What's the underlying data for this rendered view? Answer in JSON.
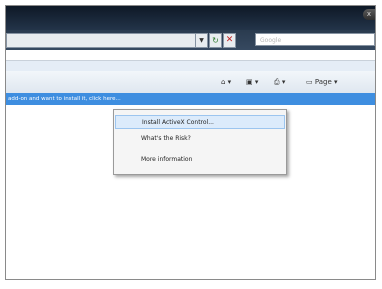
{
  "browser": {
    "close_glyph": "x",
    "address_value": "",
    "search_placeholder": "Google"
  },
  "toolbar": {
    "home_icon": "home-icon",
    "feeds_icon": "feeds-icon",
    "print_icon": "print-icon",
    "page_label": "Page ▾"
  },
  "infobar": {
    "text": "add-on and want to install it, click here..."
  },
  "context_menu": {
    "items": [
      {
        "label": "Install ActiveX Control..."
      },
      {
        "label": "What's the Risk?"
      },
      {
        "label": "More information"
      }
    ],
    "highlight_color": "#dcebfb"
  },
  "colors": {
    "titlebar": "#0e1826",
    "infobar": "#3e8ee0"
  }
}
